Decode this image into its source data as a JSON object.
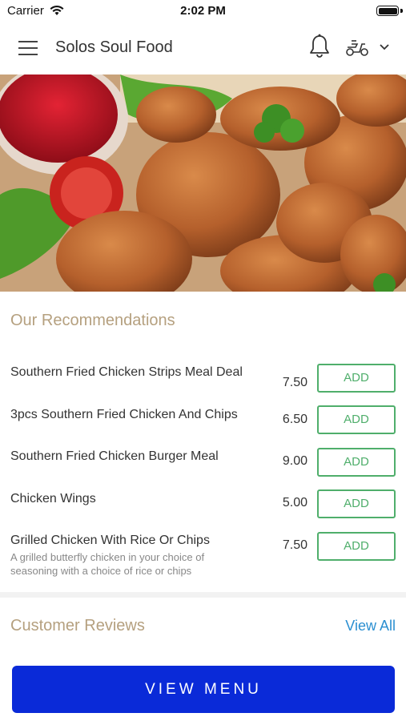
{
  "status_bar": {
    "carrier": "Carrier",
    "time": "2:02 PM",
    "wifi_icon": "wifi-icon",
    "battery_icon": "battery-icon"
  },
  "header": {
    "title": "Solos Soul Food",
    "menu_icon": "hamburger-menu-icon",
    "notification_icon": "bell-icon",
    "delivery_icon": "scooter-icon",
    "dropdown_icon": "chevron-down-icon"
  },
  "hero": {
    "description_icon": "hero-food-image"
  },
  "recommendations": {
    "title": "Our Recommendations",
    "items": [
      {
        "name": "Southern Fried Chicken Strips Meal Deal",
        "price": "7.50",
        "button": "ADD",
        "description": ""
      },
      {
        "name": "3pcs Southern Fried Chicken And Chips",
        "price": "6.50",
        "button": "ADD",
        "description": ""
      },
      {
        "name": "Southern Fried Chicken Burger Meal",
        "price": "9.00",
        "button": "ADD",
        "description": ""
      },
      {
        "name": "Chicken Wings",
        "price": "5.00",
        "button": "ADD",
        "description": ""
      },
      {
        "name": "Grilled Chicken With Rice Or Chips",
        "price": "7.50",
        "button": "ADD",
        "description": "A grilled butterfly chicken in your choice of seasoning with a choice of rice or chips"
      }
    ]
  },
  "reviews": {
    "title": "Customer Reviews",
    "view_all": "View All"
  },
  "footer": {
    "view_menu": "VIEW MENU"
  },
  "colors": {
    "accent_gold": "#b5a07f",
    "add_green": "#4fae6b",
    "link_blue": "#2b8fd1",
    "primary_button": "#0a2ad8"
  }
}
